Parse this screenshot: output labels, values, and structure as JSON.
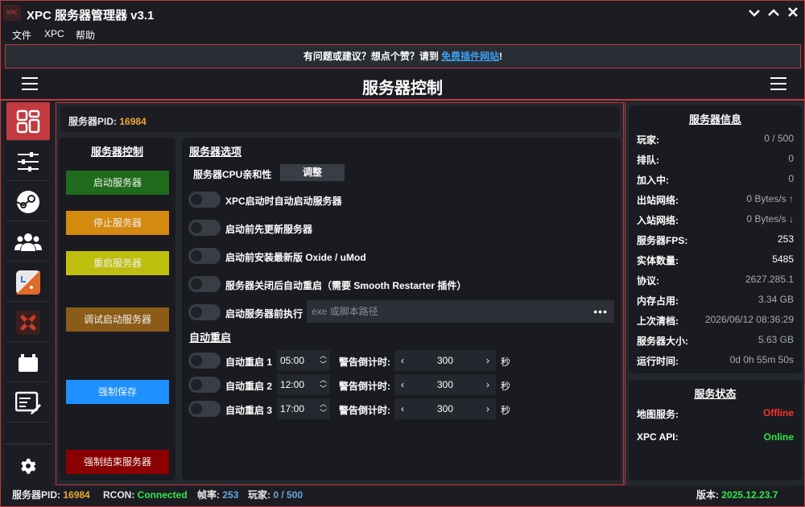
{
  "app": {
    "title": "XPC 服务器管理器 v3.1",
    "logo_text": "XPC"
  },
  "menu": [
    "文件",
    "XPC",
    "帮助"
  ],
  "banner": {
    "prefix": "有问题或建议？想点个赞？请到 ",
    "link": "免费插件网站",
    "suffix": "!"
  },
  "header": {
    "title": "服务器控制"
  },
  "pid_bar": {
    "label": "服务器PID: ",
    "value": "16984"
  },
  "server_control": {
    "heading": "服务器控制",
    "buttons": [
      {
        "label": "启动服务器",
        "color": "#1f6b1c"
      },
      {
        "label": "停止服务器",
        "color": "#d48a0e"
      },
      {
        "label": "重启服务器",
        "color": "#bebe0e"
      },
      {
        "label": "调试启动服务器",
        "color": "#8b5c17"
      },
      {
        "label": "强制保存",
        "color": "#1e90ff"
      },
      {
        "label": "强制结束服务器",
        "color": "#8b0000"
      }
    ]
  },
  "server_options": {
    "heading": "服务器选项",
    "cpu_label": "服务器CPU亲和性",
    "adjust_label": "调整",
    "toggles": [
      "XPC启动时自动启动服务器",
      "启动前先更新服务器",
      "启动前安装最新版 Oxide / uMod",
      "服务器关闭后自动重启（需要 Smooth Restarter 插件）",
      "启动服务器前执行"
    ],
    "exec_placeholder": "exe 或脚本路径",
    "exec_more": "•••"
  },
  "auto_restart": {
    "heading": "自动重启",
    "countdown_label": "警告倒计时:",
    "unit": "秒",
    "rows": [
      {
        "label": "自动重启 1",
        "time": "05:00",
        "countdown": "300"
      },
      {
        "label": "自动重启 2",
        "time": "12:00",
        "countdown": "300"
      },
      {
        "label": "自动重启 3",
        "time": "17:00",
        "countdown": "300"
      }
    ]
  },
  "server_info": {
    "heading": "服务器信息",
    "rows": [
      {
        "key": "玩家:",
        "value": "0 / 500"
      },
      {
        "key": "排队:",
        "value": "0"
      },
      {
        "key": "加入中:",
        "value": "0"
      },
      {
        "key": "出站网络:",
        "value": "0 Bytes/s ↑"
      },
      {
        "key": "入站网络:",
        "value": "0 Bytes/s ↓"
      },
      {
        "key": "服务器FPS:",
        "value": "253"
      },
      {
        "key": "实体数量:",
        "value": "5485"
      },
      {
        "key": "协议:",
        "value": "2627.285.1"
      },
      {
        "key": "内存占用:",
        "value": "3.34 GB"
      },
      {
        "key": "上次清档:",
        "value": "2026/06/12 08:36:29"
      },
      {
        "key": "服务器大小:",
        "value": "5.63 GB"
      },
      {
        "key": "运行时间:",
        "value": "0d 0h 55m 50s"
      }
    ]
  },
  "service_status": {
    "heading": "服务状态",
    "rows": [
      {
        "key": "地图服务:",
        "value": "Offline",
        "color": "#ff3030"
      },
      {
        "key": "XPC API:",
        "value": "Online",
        "color": "#2ee84a"
      }
    ]
  },
  "statusbar": {
    "pid_label": "服务器PID: ",
    "pid_value": "16984",
    "rcon_label": "RCON: ",
    "rcon_value": "Connected",
    "fps_label": "帧率: ",
    "fps_value": "253",
    "players_label": "玩家: ",
    "players_value": "0 / 500",
    "version_label": "版本: ",
    "version_value": "2025.12.23.7"
  },
  "sidebar": {
    "items": [
      "dashboard-icon",
      "sliders-icon",
      "steam-icon",
      "users-icon",
      "plugin-app-icon",
      "rust-icon",
      "battery-icon",
      "console-edit-icon",
      "gear-icon"
    ]
  }
}
